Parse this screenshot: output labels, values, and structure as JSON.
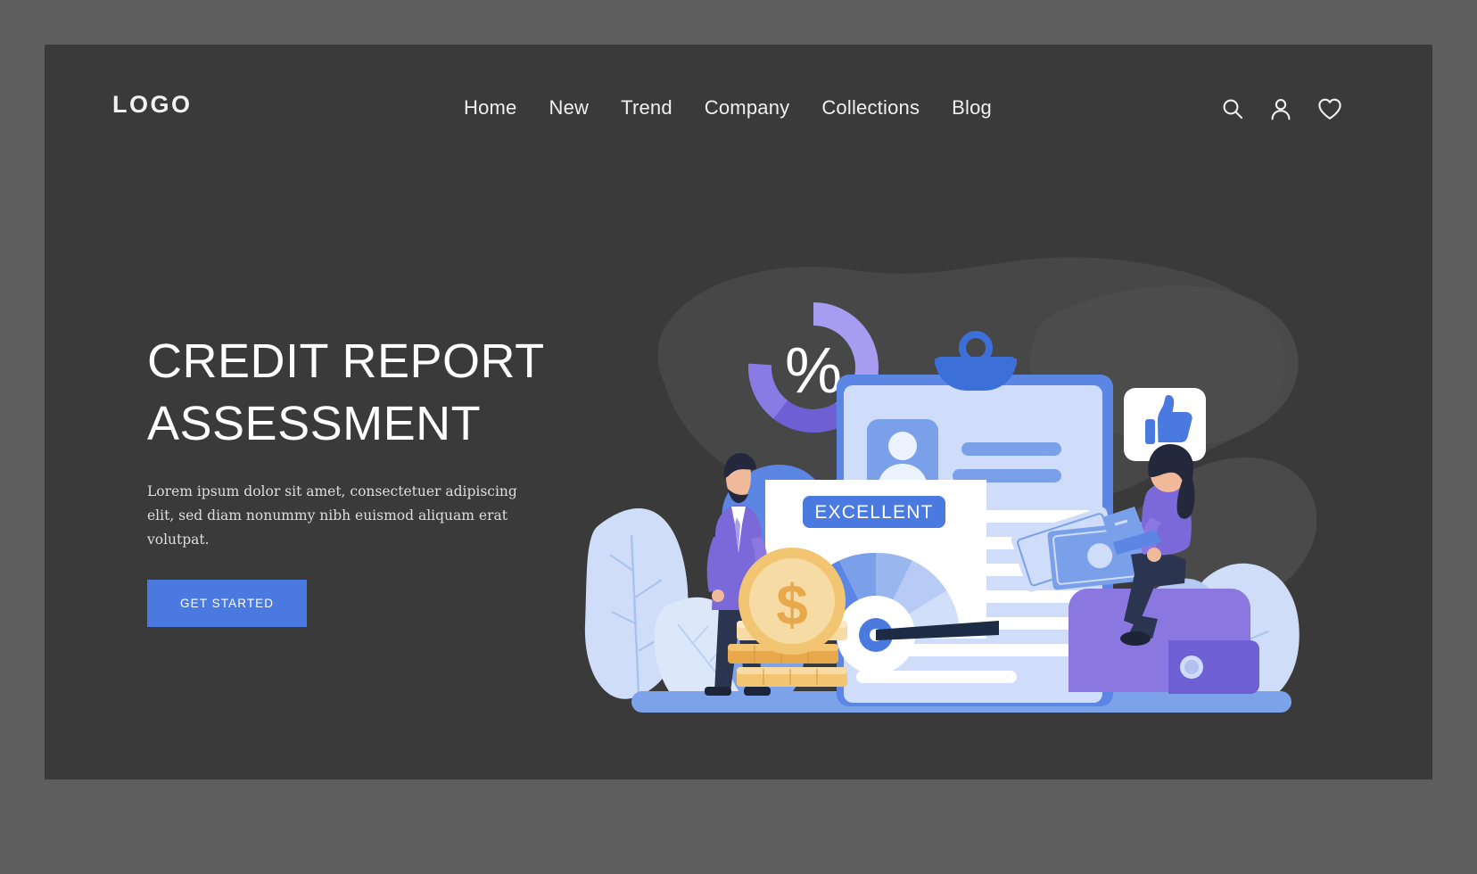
{
  "page": {
    "outer_bg": "#5e5e5e",
    "card_bg": "#3a3a3a"
  },
  "header": {
    "logo": "LOGO",
    "nav": [
      {
        "label": "Home"
      },
      {
        "label": "New"
      },
      {
        "label": "Trend"
      },
      {
        "label": "Company"
      },
      {
        "label": "Collections"
      },
      {
        "label": "Blog"
      }
    ],
    "icons": [
      {
        "name": "search-icon"
      },
      {
        "name": "user-icon"
      },
      {
        "name": "heart-icon"
      }
    ]
  },
  "hero": {
    "title": "CREDIT REPORT\nASSESSMENT",
    "subtitle": "Lorem ipsum dolor sit amet, consectetuer adipiscing elit, sed diam nonummy nibh euismod aliquam erat volutpat.",
    "cta_label": "GET STARTED",
    "cta_color": "#4a7ae0"
  },
  "illustration": {
    "percent_symbol": "%",
    "rating_badge": "EXCELLENT",
    "coin_symbol": "$",
    "colors": {
      "blue_primary": "#4a7ae0",
      "blue_mid": "#6d95e8",
      "blue_light": "#a8c2f0",
      "blue_pale": "#cfddf8",
      "purple": "#7b68d9",
      "purple_light": "#a89cf0",
      "gold": "#f2c572",
      "gold_dark": "#e8a84c",
      "blob_dark": "#4a4a4a"
    }
  }
}
